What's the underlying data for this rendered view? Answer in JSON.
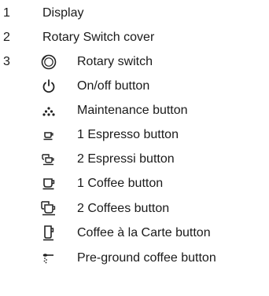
{
  "legend": {
    "items": [
      {
        "number": "1",
        "label": "Display"
      },
      {
        "number": "2",
        "label": "Rotary Switch cover"
      },
      {
        "number": "3",
        "label": "Rotary switch",
        "icon": "rotary-switch-icon"
      },
      {
        "label": "On/off button",
        "icon": "power-icon"
      },
      {
        "label": "Maintenance button",
        "icon": "maintenance-dots-icon"
      },
      {
        "label": "1 Espresso button",
        "icon": "espresso-cup-icon"
      },
      {
        "label": "2 Espressi button",
        "icon": "two-espresso-cups-icon"
      },
      {
        "label": "1 Coffee button",
        "icon": "coffee-cup-icon"
      },
      {
        "label": "2 Coffees button",
        "icon": "two-coffee-cups-icon"
      },
      {
        "label": "Coffee à la Carte button",
        "icon": "tall-cup-icon"
      },
      {
        "label": "Pre-ground coffee button",
        "icon": "spoon-icon"
      }
    ]
  }
}
